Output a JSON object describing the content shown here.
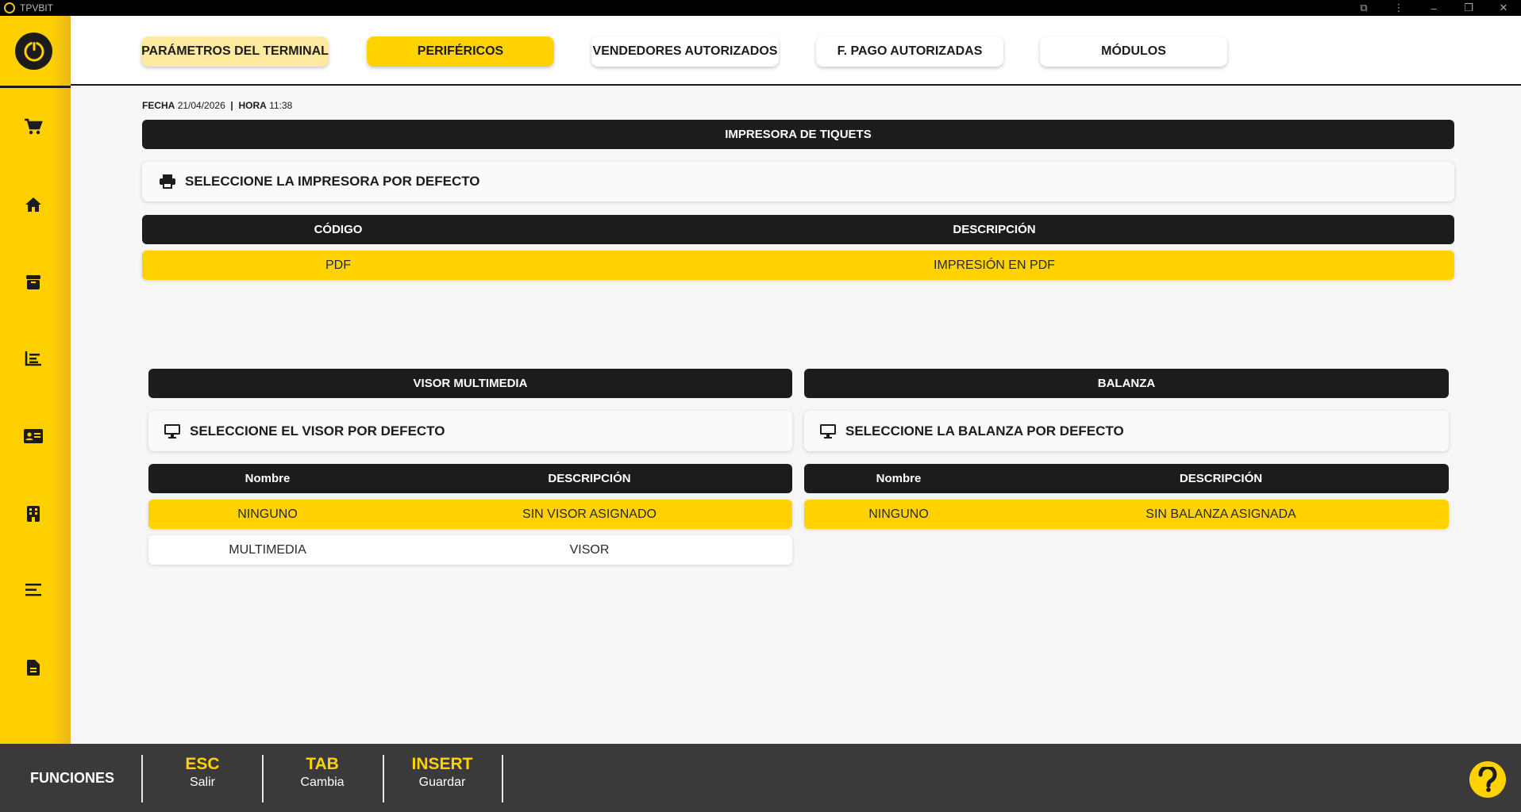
{
  "window": {
    "title": "TPVBIT"
  },
  "tabs": [
    {
      "label": "PARÁMETROS DEL TERMINAL"
    },
    {
      "label": "PERIFÉRICOS"
    },
    {
      "label": "VENDEDORES AUTORIZADOS"
    },
    {
      "label": "F. PAGO AUTORIZADAS"
    },
    {
      "label": "MÓDULOS"
    }
  ],
  "datetime": {
    "date_label": "FECHA",
    "date": "21/04/2026",
    "separator": "|",
    "time_label": "HORA",
    "time": "11:38"
  },
  "printer": {
    "section_title": "IMPRESORA DE TIQUETS",
    "select_label": "SELECCIONE LA IMPRESORA POR DEFECTO",
    "columns": [
      "CÓDIGO",
      "DESCRIPCIÓN"
    ],
    "rows": [
      {
        "code": "PDF",
        "description": "IMPRESIÓN EN PDF"
      }
    ]
  },
  "display": {
    "section_title": "VISOR MULTIMEDIA",
    "select_label": "SELECCIONE EL VISOR POR DEFECTO",
    "columns": [
      "Nombre",
      "DESCRIPCIÓN"
    ],
    "rows": [
      {
        "name": "NINGUNO",
        "description": "SIN VISOR ASIGNADO"
      },
      {
        "name": "MULTIMEDIA",
        "description": "VISOR"
      }
    ]
  },
  "scale": {
    "section_title": "BALANZA",
    "select_label": "SELECCIONE LA BALANZA POR DEFECTO",
    "columns": [
      "Nombre",
      "DESCRIPCIÓN"
    ],
    "rows": [
      {
        "name": "NINGUNO",
        "description": "SIN BALANZA ASIGNADA"
      }
    ]
  },
  "footer": {
    "label": "FUNCIONES",
    "keys": [
      {
        "key": "ESC",
        "action": "Salir"
      },
      {
        "key": "TAB",
        "action": "Cambia"
      },
      {
        "key": "INSERT",
        "action": "Guardar"
      }
    ]
  },
  "colors": {
    "accent": "#ffd200",
    "dark": "#1c1c1c",
    "footer": "#3a3a3a"
  },
  "icons": {
    "sidebar": [
      "cart-icon",
      "home-icon",
      "box-icon",
      "chart-icon",
      "id-card-icon",
      "building-icon",
      "list-icon",
      "document-icon"
    ],
    "printer": "printer-icon",
    "display": "monitor-icon",
    "scale": "monitor-icon",
    "help": "help-icon"
  }
}
